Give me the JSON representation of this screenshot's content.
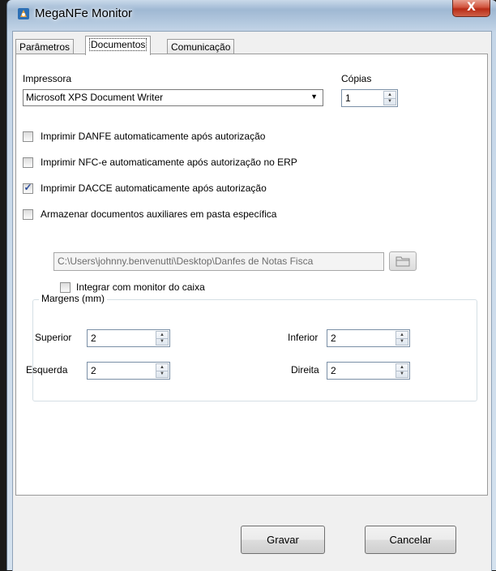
{
  "window": {
    "title": "MegaNFe Monitor",
    "close_label": "X",
    "icon": "app-icon"
  },
  "tabs": [
    {
      "label": "Parâmetros",
      "active": false
    },
    {
      "label": "Documentos",
      "active": true
    },
    {
      "label": "Comunicação",
      "active": false
    }
  ],
  "printer": {
    "label": "Impressora",
    "value": "Microsoft XPS Document Writer"
  },
  "copies": {
    "label": "Cópias",
    "value": "1"
  },
  "options": [
    {
      "label": "Imprimir DANFE automaticamente após autorização",
      "checked": false
    },
    {
      "label": "Imprimir NFC-e automaticamente após autorização no ERP",
      "checked": false
    },
    {
      "label": "Imprimir DACCE automaticamente após autorização",
      "checked": true
    },
    {
      "label": "Armazenar documentos auxiliares em pasta específica",
      "checked": false
    }
  ],
  "folder": {
    "path": "C:\\Users\\johnny.benvenutti\\Desktop\\Danfes de Notas Fisca",
    "browse_icon": "folder-icon"
  },
  "integrate": {
    "label": "Integrar com monitor do caixa",
    "checked": false
  },
  "margins": {
    "title": "Margens (mm)",
    "superior": {
      "label": "Superior",
      "value": "2"
    },
    "inferior": {
      "label": "Inferior",
      "value": "2"
    },
    "esquerda": {
      "label": "Esquerda",
      "value": "2"
    },
    "direita": {
      "label": "Direita",
      "value": "2"
    }
  },
  "buttons": {
    "save": "Gravar",
    "cancel": "Cancelar"
  }
}
